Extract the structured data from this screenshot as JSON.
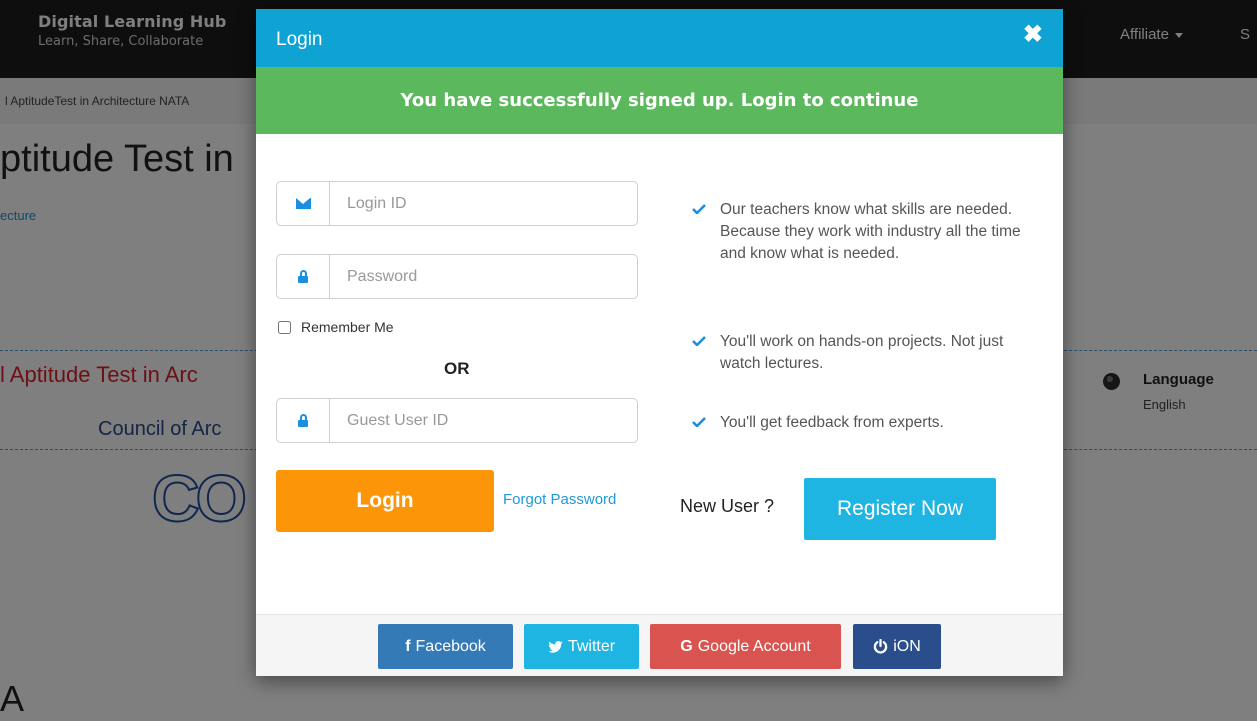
{
  "background": {
    "brand": {
      "title": "Digital Learning Hub",
      "subtitle": "Learn, Share, Collaborate"
    },
    "nav": {
      "affiliate": "Affiliate",
      "partial_item": "S"
    },
    "breadcrumb": "l AptitudeTest in Architecture NATA",
    "page_title": "ptitude Test in",
    "category": "ecture",
    "red_title": "l Aptitude Test in Arc",
    "council": "Council of Arc",
    "logo_letters": "CO",
    "language": {
      "title": "Language",
      "value": "English"
    },
    "big_letter": "A"
  },
  "modal": {
    "title": "Login",
    "close_symbol": "✖",
    "alert": "You have successfully signed up. Login to continue",
    "login_id_placeholder": "Login ID",
    "password_placeholder": "Password",
    "remember_label": "Remember Me",
    "or_text": "OR",
    "guest_placeholder": "Guest User ID",
    "login_button": "Login",
    "forgot_link": "Forgot Password",
    "features": [
      "Our teachers know what skills are needed. Because they work with industry all the time and know what is needed.",
      "You'll work on hands-on projects. Not just watch lectures.",
      "You'll get feedback from experts."
    ],
    "new_user_label": "New User ?",
    "register_button": "Register Now",
    "social": [
      {
        "label": "Facebook",
        "icon": "f"
      },
      {
        "label": "Twitter",
        "icon": "bird"
      },
      {
        "label": "Google Account",
        "icon": "G"
      },
      {
        "label": "iON",
        "icon": "power"
      }
    ]
  },
  "colors": {
    "header": "#0fa3d4",
    "alert": "#5cb85c",
    "login": "#fd9508",
    "register": "#1fb5e3",
    "facebook": "#337ab7",
    "twitter": "#1fb5e3",
    "google": "#d9534f",
    "ion": "#2a4e8c"
  }
}
